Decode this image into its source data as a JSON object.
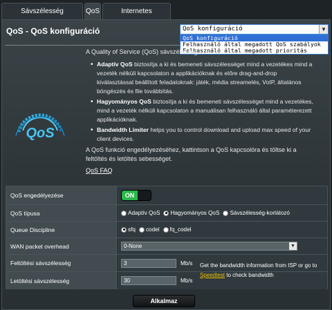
{
  "tabs": [
    {
      "label": "Sávszélesség monitorozása"
    },
    {
      "label": "QoS"
    },
    {
      "label": "Internetes Előzmények"
    }
  ],
  "page_title": "QoS - QoS konfiguráció",
  "config_dropdown": {
    "value": "QoS konfiguráció",
    "options": [
      "QoS konfiguráció",
      "Felhasználó által megadott QoS szabályok",
      "Felhasználó által megadott prioritás"
    ]
  },
  "description": {
    "intro": "A Quality of Service (QoS) sávszélesség",
    "bullets": [
      {
        "title": "Adaptív QoS",
        "text": "biztosítja a ki és bemeneti sávszélességet mind a vezetékes mind a vezeték nélküli kapcsolaton a applikációknak és előre drag-and-drop kiválasztással beállított feladatoknak: játék, média streamelés, VoIP, általános böngészés és file továbbítás."
      },
      {
        "title": "Hagyományos QoS",
        "text": "biztosítja a ki és bemeneti sávszélességet mind a vezetékes, mind a vezeték nélküli kapcsolaton a manuálisan felhasználó által paraméterezett applikációknak."
      },
      {
        "title": "Bandwidth Limiter",
        "text": "helps you to control download and upload max speed of your client devices."
      }
    ],
    "enable_note": "A QoS funkció engedélyezéséhez, kattintson a QoS kapcsolóra és töltse ki a feltöltés és letöltés sebességet.",
    "faq_link": "QoS FAQ"
  },
  "logo_text": "QoS",
  "settings": {
    "enable": {
      "label": "QoS engedélyezése",
      "state": "ON"
    },
    "type": {
      "label": "QoS típusa",
      "options": [
        "Adaptív QoS",
        "Hagyományos QoS",
        "Sávszélesség-korlátozó"
      ],
      "selected_index": 1
    },
    "queue": {
      "label": "Queue Discipline",
      "options": [
        "sfq",
        "codel",
        "fq_codel"
      ],
      "selected_index": 0
    },
    "wan_overhead": {
      "label": "WAN packet overhead",
      "value": "0-None"
    },
    "upload": {
      "label": "Feltöltési sávszélesség",
      "value": "3",
      "unit": "Mb/s"
    },
    "download": {
      "label": "Letöltési sávszélesség",
      "value": "30",
      "unit": "Mb/s"
    }
  },
  "bandwidth_info": {
    "text_before": "Get the bandwidth information from ISP or go to",
    "link": "Speedtest",
    "text_after": "to check bandwidth"
  },
  "apply_label": "Alkalmaz",
  "colors": {
    "toggle_on": "#2ab74a",
    "link": "#f3c400",
    "selection": "#2f6fd6"
  }
}
